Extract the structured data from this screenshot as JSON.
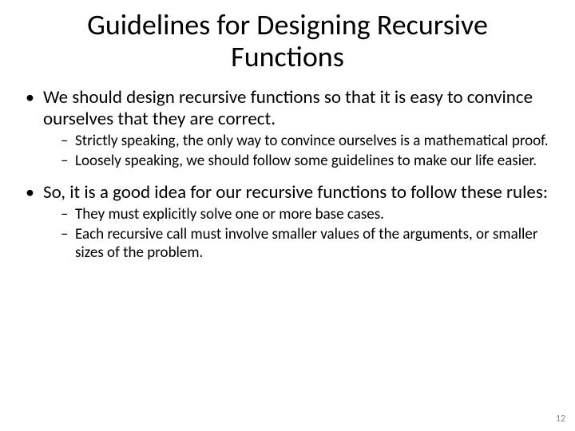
{
  "title": "Guidelines for Designing Recursive Functions",
  "bullets": [
    {
      "text": "We should design recursive functions so that it is easy to convince ourselves that they are correct.",
      "sub": [
        "Strictly speaking, the only way to convince ourselves is a mathematical proof.",
        "Loosely speaking, we should follow some guidelines to make our life easier."
      ]
    },
    {
      "text": "So, it is a good idea for our recursive functions to follow these rules:",
      "sub": [
        "They must explicitly solve one or more base cases.",
        "Each recursive call must involve smaller values of the arguments, or smaller sizes of the problem."
      ]
    }
  ],
  "page_number": "12"
}
